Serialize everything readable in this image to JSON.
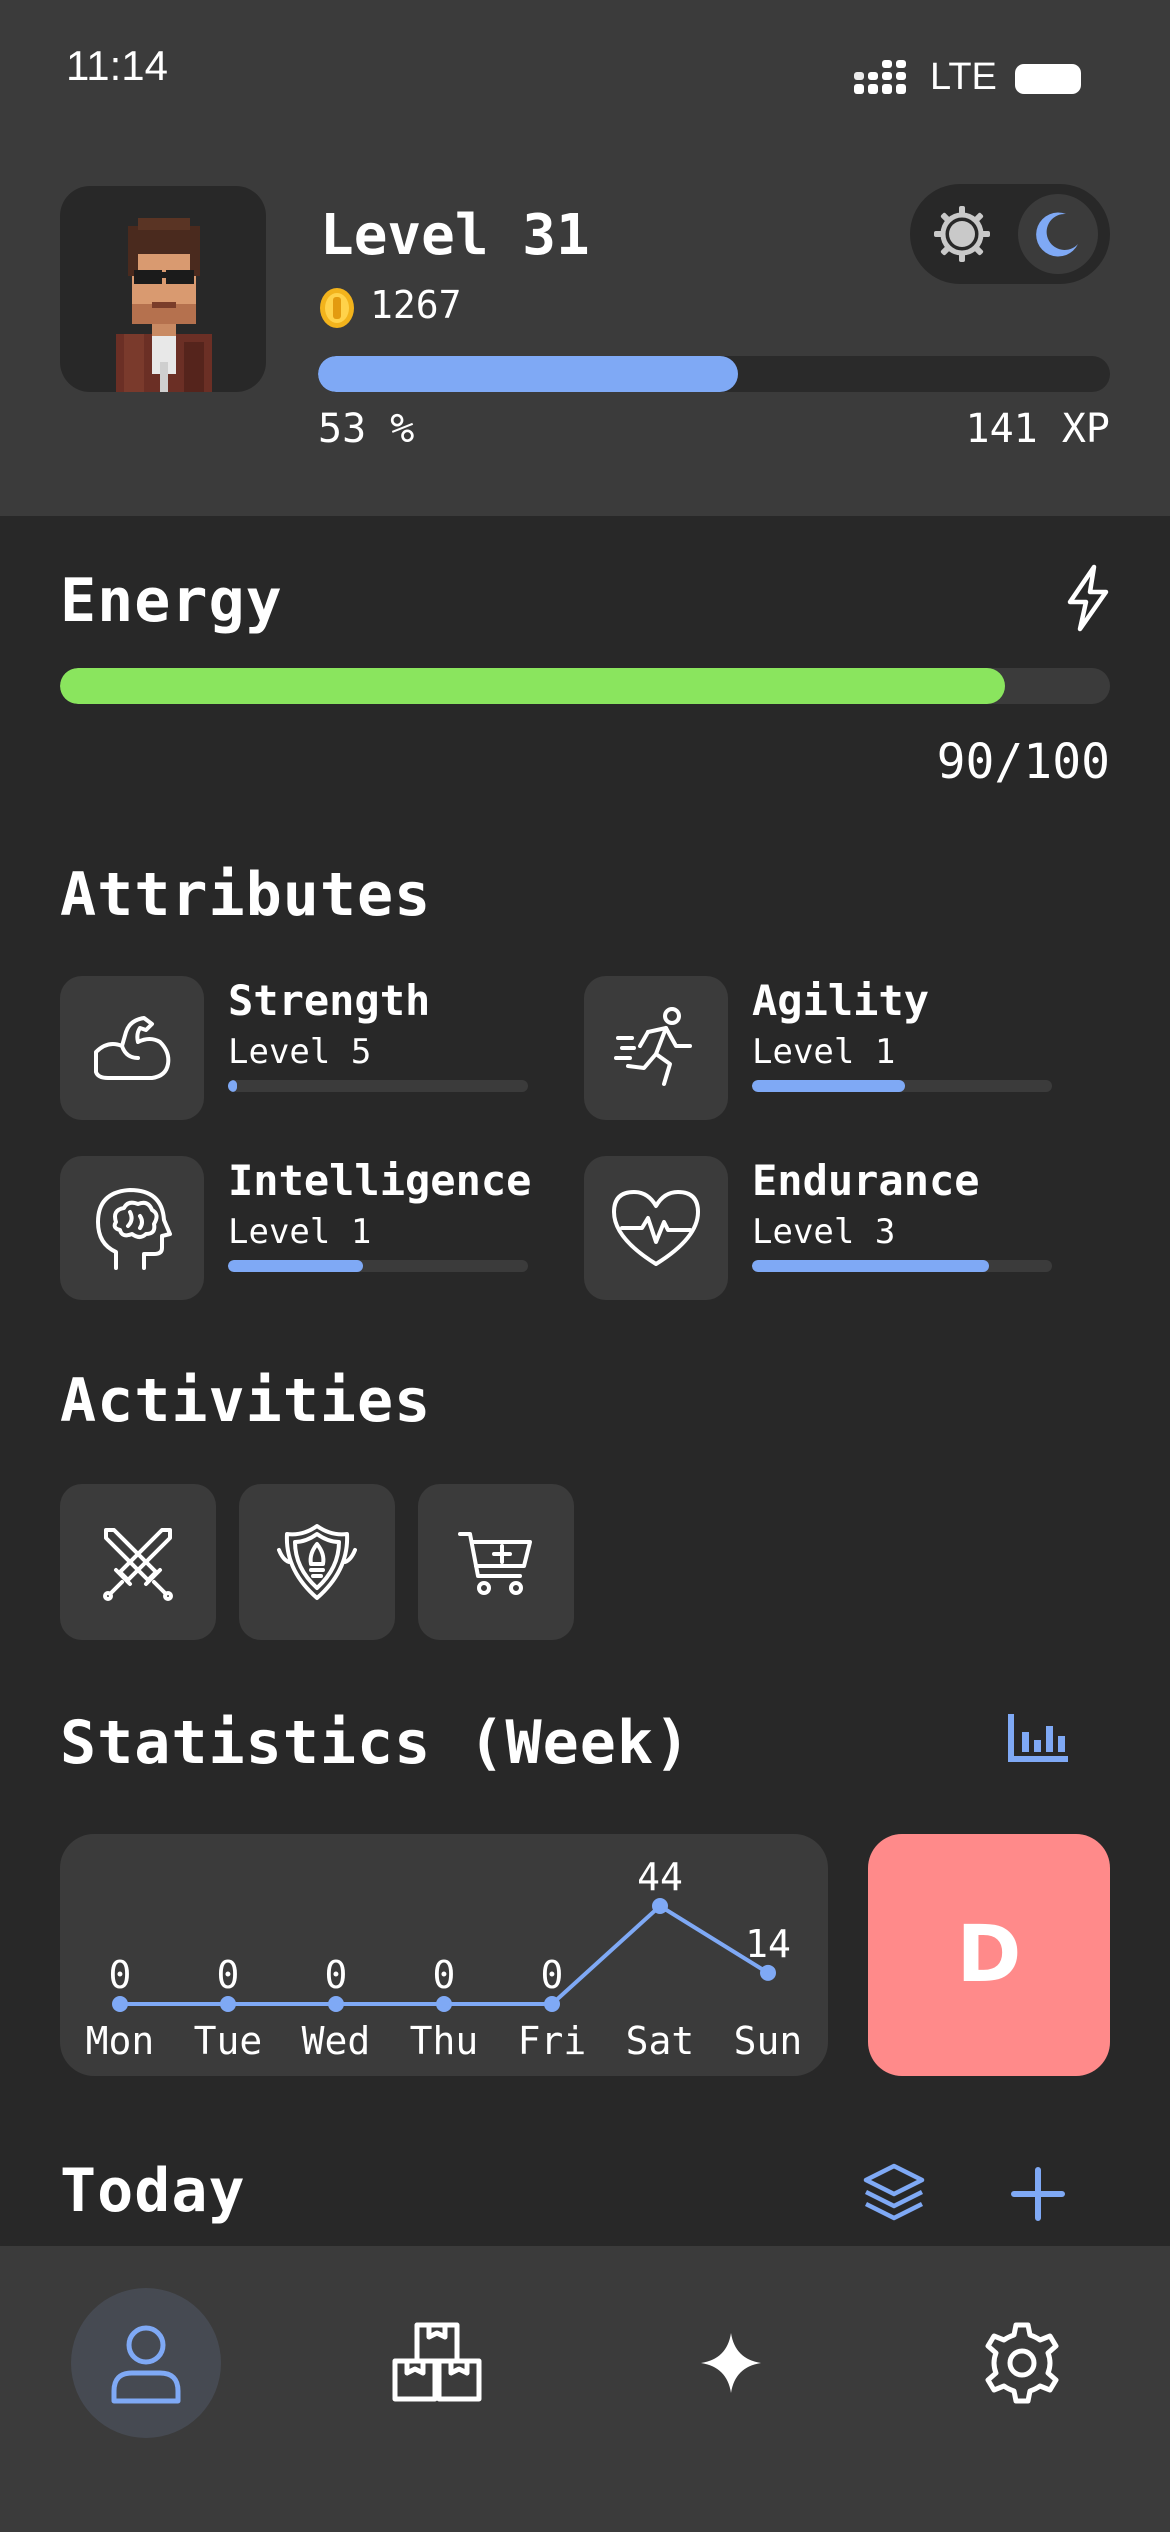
{
  "status_bar": {
    "time": "11:14",
    "network": "LTE"
  },
  "profile": {
    "level_label": "Level 31",
    "coins": "1267",
    "xp_progress": 0.53,
    "xp_percent_label": "53 %",
    "xp_points_label": "141 XP"
  },
  "theme_toggle": {
    "options": [
      "sun-icon",
      "moon-icon"
    ],
    "selected": "moon-icon"
  },
  "energy": {
    "title": "Energy",
    "value_label": "90/100",
    "value": 90,
    "max": 100
  },
  "attributes": {
    "title": "Attributes",
    "items": [
      {
        "name": "Strength",
        "level": "Level 5",
        "progress": 0.03,
        "icon": "flexed-arm-icon"
      },
      {
        "name": "Agility",
        "level": "Level 1",
        "progress": 0.51,
        "icon": "running-person-icon"
      },
      {
        "name": "Intelligence",
        "level": "Level 1",
        "progress": 0.45,
        "icon": "brain-head-icon"
      },
      {
        "name": "Endurance",
        "level": "Level 3",
        "progress": 0.79,
        "icon": "heartbeat-icon"
      }
    ]
  },
  "activities": {
    "title": "Activities",
    "items": [
      {
        "icon": "crossed-swords-icon"
      },
      {
        "icon": "shield-icon"
      },
      {
        "icon": "cart-add-icon"
      }
    ]
  },
  "statistics": {
    "title": "Statistics (Week)",
    "grade": "D",
    "colors": {
      "line": "#7fa9f5",
      "grade_bg": "#ff8a8a"
    }
  },
  "chart_data": {
    "type": "line",
    "categories": [
      "Mon",
      "Tue",
      "Wed",
      "Thu",
      "Fri",
      "Sat",
      "Sun"
    ],
    "values": [
      0,
      0,
      0,
      0,
      0,
      44,
      14
    ],
    "title": "",
    "xlabel": "",
    "ylabel": "",
    "grid": false,
    "data_labels": true
  },
  "today": {
    "title": "Today"
  },
  "nav": {
    "items": [
      {
        "icon": "person-icon",
        "active": true
      },
      {
        "icon": "boxes-icon",
        "active": false
      },
      {
        "icon": "sparkle-icon",
        "active": false
      },
      {
        "icon": "gear-icon",
        "active": false
      }
    ]
  },
  "colors": {
    "accent": "#7fa9f5",
    "energy": "#8ae55e",
    "background": "#282828",
    "surface": "#3b3b3b"
  }
}
